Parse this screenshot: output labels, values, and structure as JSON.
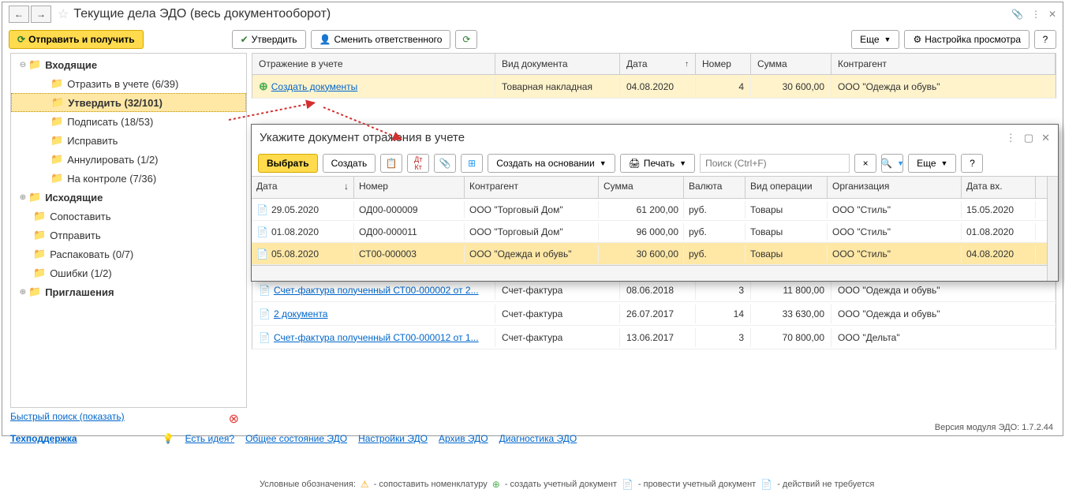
{
  "window": {
    "title": "Текущие дела ЭДО (весь документооборот)"
  },
  "toolbar": {
    "send_receive": "Отправить и получить",
    "approve": "Утвердить",
    "change_responsible": "Сменить ответственного",
    "more": "Еще",
    "view_settings": "Настройка просмотра",
    "help": "?"
  },
  "tree": [
    {
      "label": "Входящие",
      "bold": true,
      "expand": "−",
      "indent": 0
    },
    {
      "label": "Отразить в учете (6/39)",
      "indent": 2
    },
    {
      "label": "Утвердить (32/101)",
      "bold": true,
      "selected": true,
      "indent": 2
    },
    {
      "label": "Подписать (18/53)",
      "indent": 2
    },
    {
      "label": "Исправить",
      "indent": 2
    },
    {
      "label": "Аннулировать (1/2)",
      "indent": 2
    },
    {
      "label": "На контроле (7/36)",
      "indent": 2
    },
    {
      "label": "Исходящие",
      "bold": true,
      "expand": "+",
      "indent": 0
    },
    {
      "label": "Сопоставить",
      "indent": 1
    },
    {
      "label": "Отправить",
      "indent": 1
    },
    {
      "label": "Распаковать (0/7)",
      "indent": 1
    },
    {
      "label": "Ошибки (1/2)",
      "indent": 1
    },
    {
      "label": "Приглашения",
      "bold": true,
      "expand": "+",
      "indent": 0
    }
  ],
  "main_table": {
    "headers": {
      "reflect": "Отражение в учете",
      "doc_type": "Вид документа",
      "date": "Дата",
      "number": "Номер",
      "sum": "Сумма",
      "counterparty": "Контрагент"
    },
    "rows": [
      {
        "action": "Создать документы",
        "icon": "plus",
        "doc_type": "Товарная накладная",
        "date": "04.08.2020",
        "number": "4",
        "sum": "30 600,00",
        "counterparty": "ООО \"Одежда и обувь\"",
        "highlight": true
      },
      {
        "action": "Счет-фактура полученный СТ00-000002 от 2...",
        "icon": "doc",
        "doc_type": "Счет-фактура",
        "date": "08.06.2018",
        "number": "3",
        "sum": "11 800,00",
        "counterparty": "ООО \"Одежда и обувь\""
      },
      {
        "action": "2 документа",
        "icon": "doc",
        "doc_type": "Счет-фактура",
        "date": "26.07.2017",
        "number": "14",
        "sum": "33 630,00",
        "counterparty": "ООО \"Одежда и обувь\""
      },
      {
        "action": "Счет-фактура полученный СТ00-000012 от 1...",
        "icon": "doc",
        "doc_type": "Счет-фактура",
        "date": "13.06.2017",
        "number": "3",
        "sum": "70 800,00",
        "counterparty": "ООО \"Дельта\""
      }
    ]
  },
  "popup": {
    "title": "Укажите документ отражения в учете",
    "toolbar": {
      "select": "Выбрать",
      "create": "Создать",
      "create_based": "Создать на основании",
      "print": "Печать",
      "search_placeholder": "Поиск (Ctrl+F)",
      "more": "Еще",
      "help": "?"
    },
    "headers": {
      "date": "Дата",
      "number": "Номер",
      "counterparty": "Контрагент",
      "sum": "Сумма",
      "currency": "Валюта",
      "op_type": "Вид операции",
      "org": "Организация",
      "date_in": "Дата вх."
    },
    "rows": [
      {
        "date": "29.05.2020",
        "number": "ОД00-000009",
        "counterparty": "ООО \"Торговый Дом\"",
        "sum": "61 200,00",
        "currency": "руб.",
        "op_type": "Товары",
        "org": "ООО \"Стиль\"",
        "date_in": "15.05.2020"
      },
      {
        "date": "01.08.2020",
        "number": "ОД00-000011",
        "counterparty": "ООО \"Торговый Дом\"",
        "sum": "96 000,00",
        "currency": "руб.",
        "op_type": "Товары",
        "org": "ООО \"Стиль\"",
        "date_in": "01.08.2020"
      },
      {
        "date": "05.08.2020",
        "number": "СТ00-000003",
        "counterparty": "ООО \"Одежда и обувь\"",
        "sum": "30 600,00",
        "currency": "руб.",
        "op_type": "Товары",
        "org": "ООО \"Стиль\"",
        "date_in": "04.08.2020",
        "selected": true
      }
    ]
  },
  "footer": {
    "quick_search": "Быстрый поиск (показать)",
    "support": "Техподдержка",
    "idea": "Есть идея?",
    "link1": "Общее состояние ЭДО",
    "link2": "Настройки ЭДО",
    "link3": "Архив ЭДО",
    "link4": "Диагностика ЭДО",
    "legend_label": "Условные обозначения:",
    "legend1": "- сопоставить номенклатуру",
    "legend2": "- создать учетный документ",
    "legend3": "- провести учетный документ",
    "legend4": "- действий не требуется",
    "version": "Версия модуля ЭДО: 1.7.2.44"
  }
}
